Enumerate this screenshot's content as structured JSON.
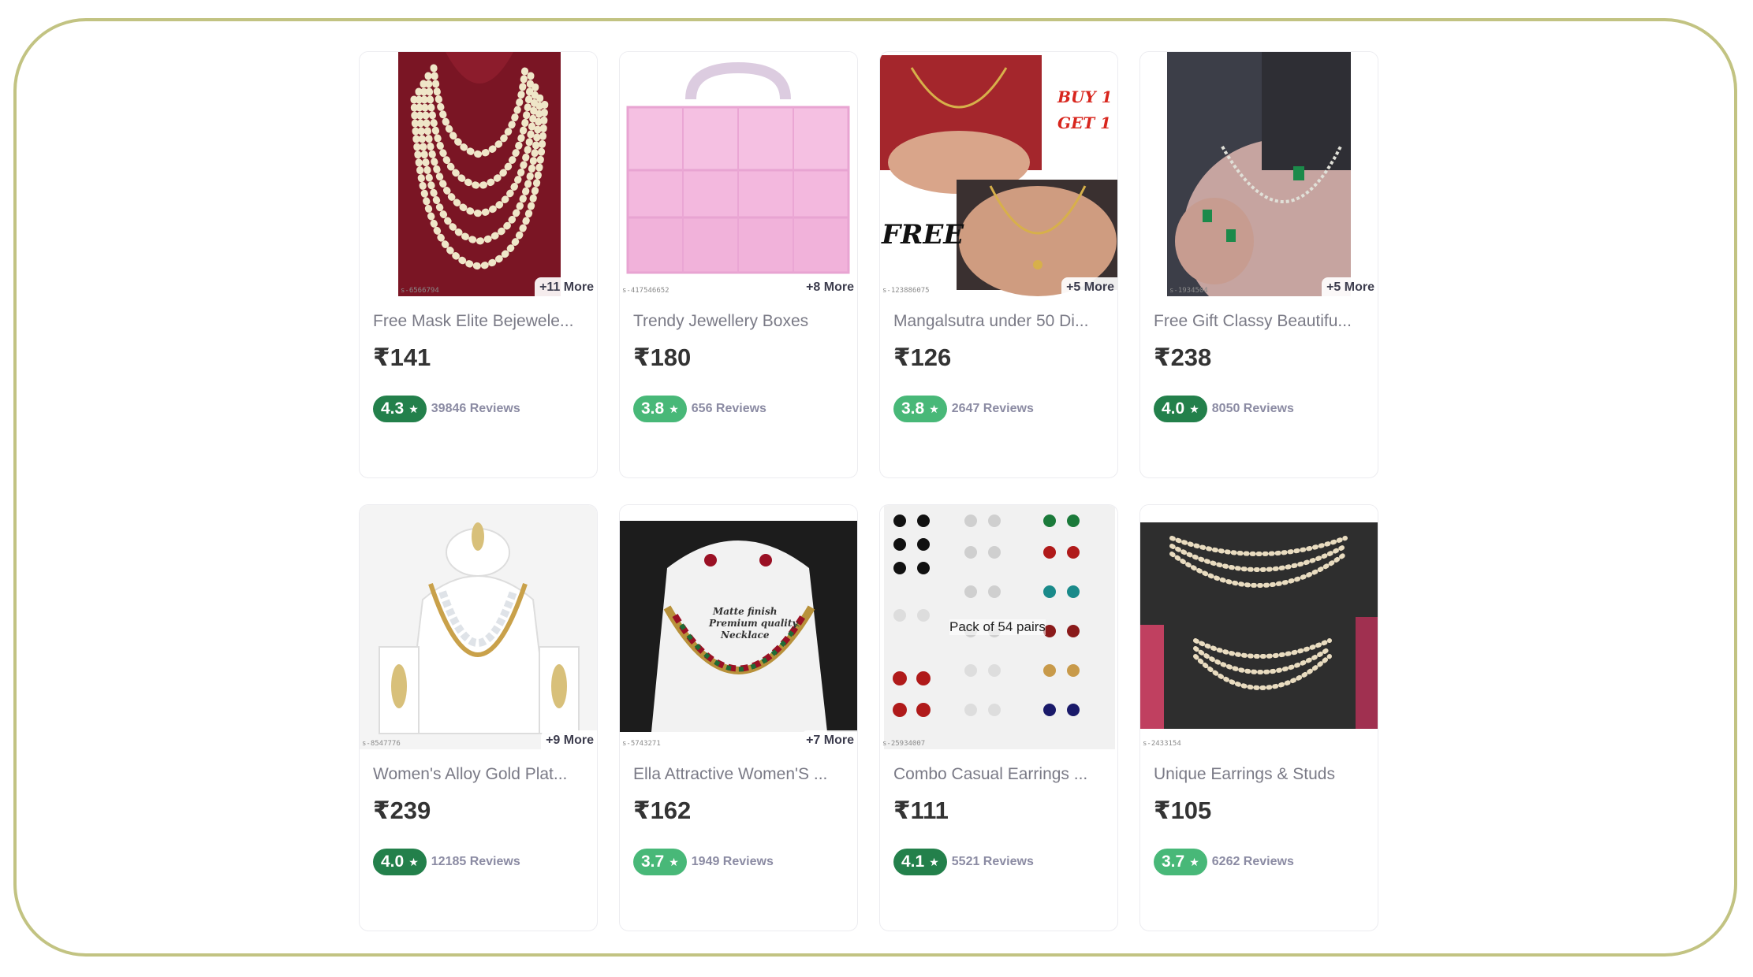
{
  "products": [
    {
      "title": "Free Mask Elite Bejewele...",
      "price": "₹141",
      "rating": "4.3",
      "reviews": "39846 Reviews",
      "more": "+11 More",
      "sku": "s-6566794",
      "rating_color": "#23804b"
    },
    {
      "title": "Trendy Jewellery Boxes",
      "price": "₹180",
      "rating": "3.8",
      "reviews": "656 Reviews",
      "more": "+8 More",
      "sku": "s-417546652",
      "rating_color": "#48b878"
    },
    {
      "title": "Mangalsutra under 50 Di...",
      "price": "₹126",
      "rating": "3.8",
      "reviews": "2647 Reviews",
      "more": "+5 More",
      "sku": "s-123886075",
      "rating_color": "#48b878",
      "overlay_1": "BUY 1",
      "overlay_2": "GET 1",
      "overlay_3": "FREE"
    },
    {
      "title": "Free Gift Classy Beautifu...",
      "price": "₹238",
      "rating": "4.0",
      "reviews": "8050 Reviews",
      "more": "+5 More",
      "sku": "s-1934504",
      "rating_color": "#23804b"
    },
    {
      "title": "Women's Alloy Gold Plat...",
      "price": "₹239",
      "rating": "4.0",
      "reviews": "12185 Reviews",
      "more": "+9 More",
      "sku": "s-8547776",
      "rating_color": "#23804b"
    },
    {
      "title": "Ella Attractive Women'S ...",
      "price": "₹162",
      "rating": "3.7",
      "reviews": "1949 Reviews",
      "more": "+7 More",
      "sku": "s-5743271",
      "rating_color": "#48b878",
      "overlay_1": "Matte finish",
      "overlay_2": "Premium quality",
      "overlay_3": "Necklace"
    },
    {
      "title": "Combo Casual Earrings ...",
      "price": "₹111",
      "rating": "4.1",
      "reviews": "5521 Reviews",
      "more": "",
      "sku": "s-25934007",
      "rating_color": "#23804b",
      "overlay_1": "Pack of 54 pairs"
    },
    {
      "title": "Unique Earrings & Studs",
      "price": "₹105",
      "rating": "3.7",
      "reviews": "6262 Reviews",
      "more": "",
      "sku": "s-2433154",
      "rating_color": "#48b878"
    }
  ]
}
